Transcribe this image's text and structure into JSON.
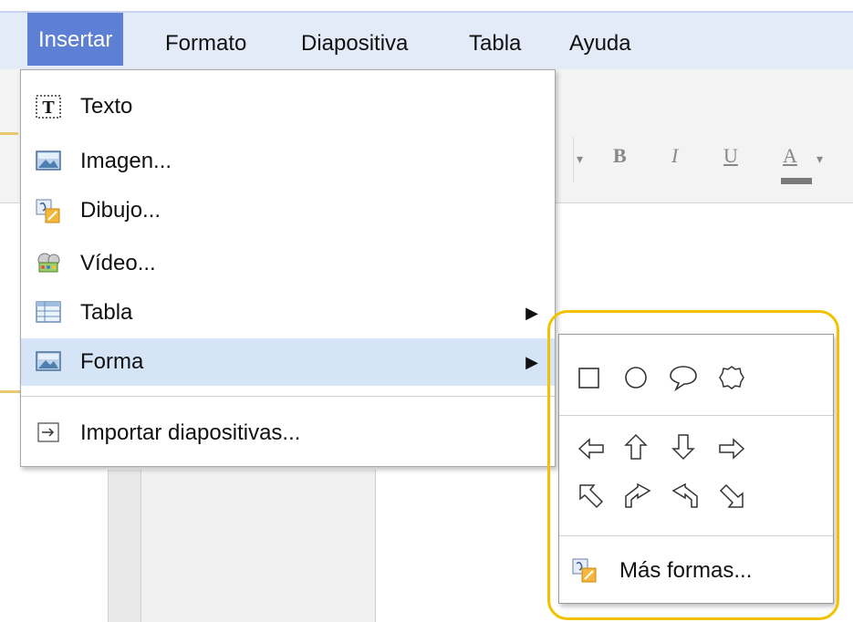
{
  "menubar": {
    "items": [
      "Insertar",
      "Formato",
      "Diapositiva",
      "Tabla",
      "Ayuda"
    ],
    "active": "Insertar"
  },
  "toolbar": {
    "bold": "B",
    "italic": "I",
    "underline": "U",
    "font_color": "A"
  },
  "insert_menu": {
    "items": [
      {
        "label": "Texto",
        "icon": "text-box-icon"
      },
      {
        "label": "Imagen...",
        "icon": "image-icon"
      },
      {
        "label": "Dibujo...",
        "icon": "drawing-icon"
      },
      {
        "label": "Vídeo...",
        "icon": "video-icon"
      },
      {
        "label": "Tabla",
        "icon": "table-icon",
        "submenu": true
      },
      {
        "label": "Forma",
        "icon": "shape-icon",
        "submenu": true,
        "highlighted": true
      },
      {
        "label": "Importar diapositivas...",
        "icon": "import-icon"
      }
    ]
  },
  "shape_submenu": {
    "basic_shapes": [
      "rectangle",
      "ellipse",
      "speech-bubble",
      "starburst"
    ],
    "arrows_row1": [
      "arrow-left",
      "arrow-up",
      "arrow-down",
      "arrow-right"
    ],
    "arrows_row2": [
      "arrow-up-left",
      "arrow-up-right-bent",
      "arrow-down-left-bent",
      "arrow-down-right"
    ],
    "more_label": "Más formas..."
  },
  "colors": {
    "menubar_bg": "#e4ebf8",
    "active_menu": "#5d7fd4",
    "highlight_row": "#d6e4f7",
    "callout_ring": "#f2c200"
  }
}
